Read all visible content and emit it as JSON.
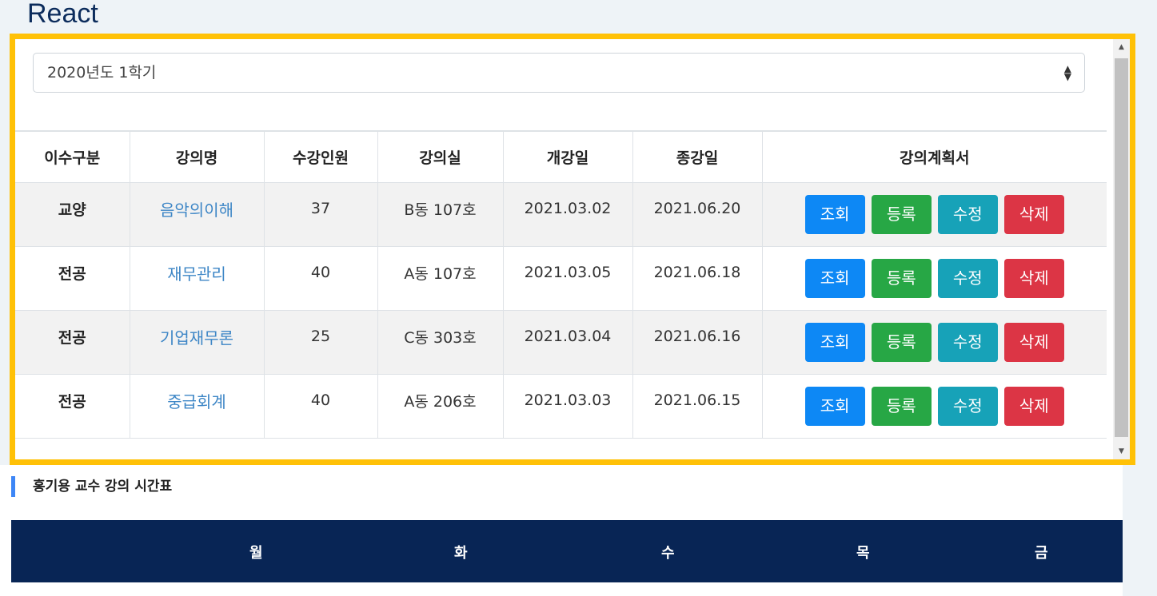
{
  "app": {
    "title": "React"
  },
  "semester_select": {
    "selected": "2020년도 1학기"
  },
  "course_table": {
    "headers": [
      "이수구분",
      "강의명",
      "수강인원",
      "강의실",
      "개강일",
      "종강일",
      "강의계획서"
    ],
    "rows": [
      {
        "type": "교양",
        "name": "음악의이해",
        "enrolled": "37",
        "room": "B동 107호",
        "start": "2021.03.02",
        "end": "2021.06.20"
      },
      {
        "type": "전공",
        "name": "재무관리",
        "enrolled": "40",
        "room": "A동 107호",
        "start": "2021.03.05",
        "end": "2021.06.18"
      },
      {
        "type": "전공",
        "name": "기업재무론",
        "enrolled": "25",
        "room": "C동 303호",
        "start": "2021.03.04",
        "end": "2021.06.16"
      },
      {
        "type": "전공",
        "name": "중급회계",
        "enrolled": "40",
        "room": "A동 206호",
        "start": "2021.03.03",
        "end": "2021.06.15"
      }
    ],
    "actions": {
      "view": "조회",
      "register": "등록",
      "edit": "수정",
      "delete": "삭제"
    }
  },
  "timetable": {
    "title": "홍기용 교수 강의 시간표",
    "days": [
      "월",
      "화",
      "수",
      "목",
      "금"
    ]
  },
  "colors": {
    "highlight_border": "#ffc107",
    "view_button": "#0d88f5",
    "register_button": "#27a745",
    "edit_button": "#17a2b8",
    "delete_button": "#dc3545",
    "timetable_header": "#082555",
    "link": "#3d86c6"
  }
}
